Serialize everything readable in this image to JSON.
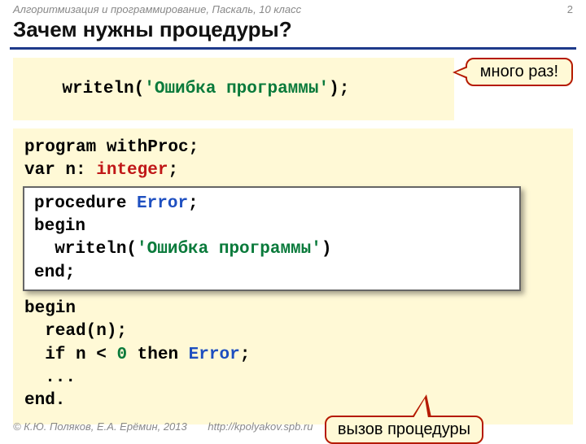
{
  "meta": {
    "header": "Алгоритмизация и программирование, Паскаль, 10 класс",
    "page": "2",
    "copyright": "© К.Ю. Поляков, Е.А. Ерёмин, 2013",
    "url": "http://kpolyakov.spb.ru"
  },
  "title": "Зачем нужны процедуры?",
  "snippet": {
    "writeln": "writeln",
    "open_paren": "(",
    "str": "'Ошибка программы'",
    "close": ");"
  },
  "callout_many": "много раз!",
  "callout_call": "вызов\nпроцедуры",
  "prog": {
    "l1a": "program",
    "l1b": " withProc;",
    "l2a": "var",
    "l2b": " n: ",
    "l2c": "integer",
    "l2d": ";"
  },
  "proc": {
    "l1a": "procedure ",
    "l1b": "Error",
    "l1c": ";",
    "l2": "begin",
    "l3a": "  writeln(",
    "l3b": "'Ошибка программы'",
    "l3c": ")",
    "l4": "end;"
  },
  "main": {
    "l1": "begin",
    "l2": "  read(n);",
    "l3a": "  if",
    "l3b": " n < ",
    "l3c": "0",
    "l3d": " then ",
    "l3e": "Error",
    "l3f": ";",
    "l4": "  ...",
    "l5": "end."
  }
}
